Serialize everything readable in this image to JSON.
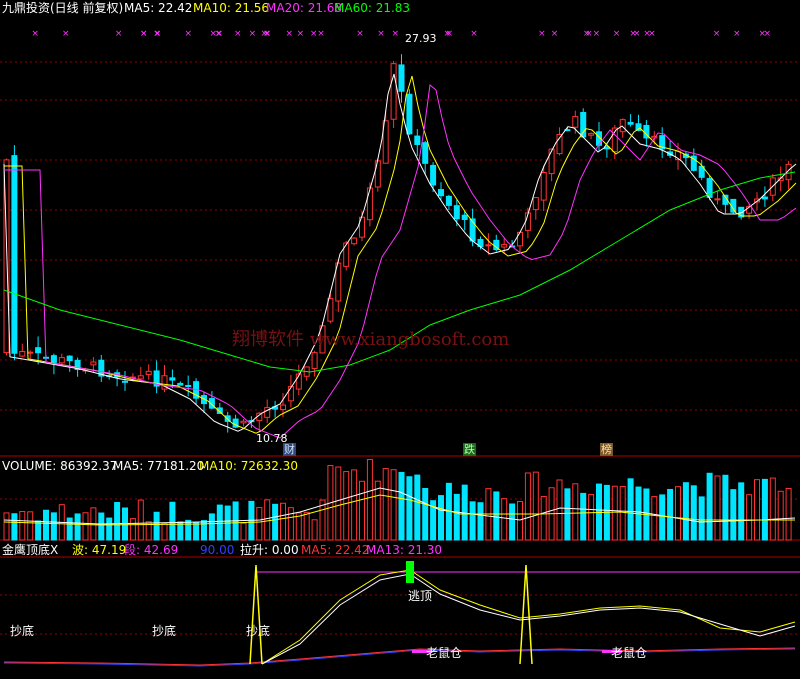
{
  "header": {
    "title": "九鼎投资(日线 前复权)",
    "ma5": "MA5: 22.42",
    "ma10": "MA10: 21.56",
    "ma20": "MA20: 21.68",
    "ma60": "MA60: 21.83"
  },
  "price_panel": {
    "high_label": "27.93",
    "low_label": "10.78",
    "watermark": "翔博软件 www.xiangbosoft.com",
    "markers": [
      "财",
      "跌",
      "榜"
    ]
  },
  "volume_panel": {
    "volume": "VOLUME: 86392.37",
    "ma5": "MA5: 77181.20",
    "ma10": "MA10: 72632.30"
  },
  "indicator_panel": {
    "name": "金鹰顶底X",
    "wave": "波: 47.19",
    "seg": "段: 42.69",
    "level": "90.00",
    "lift": "拉升: 0.00",
    "ma5": "MA5: 22.42",
    "ma13": "MA13: 21.30",
    "signals": {
      "bottom1": "抄底",
      "bottom2": "抄底",
      "bottom3": "抄底",
      "escape": "逃顶",
      "rat1": "老鼠仓",
      "rat2": "老鼠仓"
    }
  },
  "colors": {
    "up": "#ff3232",
    "down": "#00e5ff",
    "ma5": "#ffffff",
    "ma10": "#ffff00",
    "ma20": "#ff33ff",
    "ma60": "#00ff00",
    "grid": "#900000"
  }
}
